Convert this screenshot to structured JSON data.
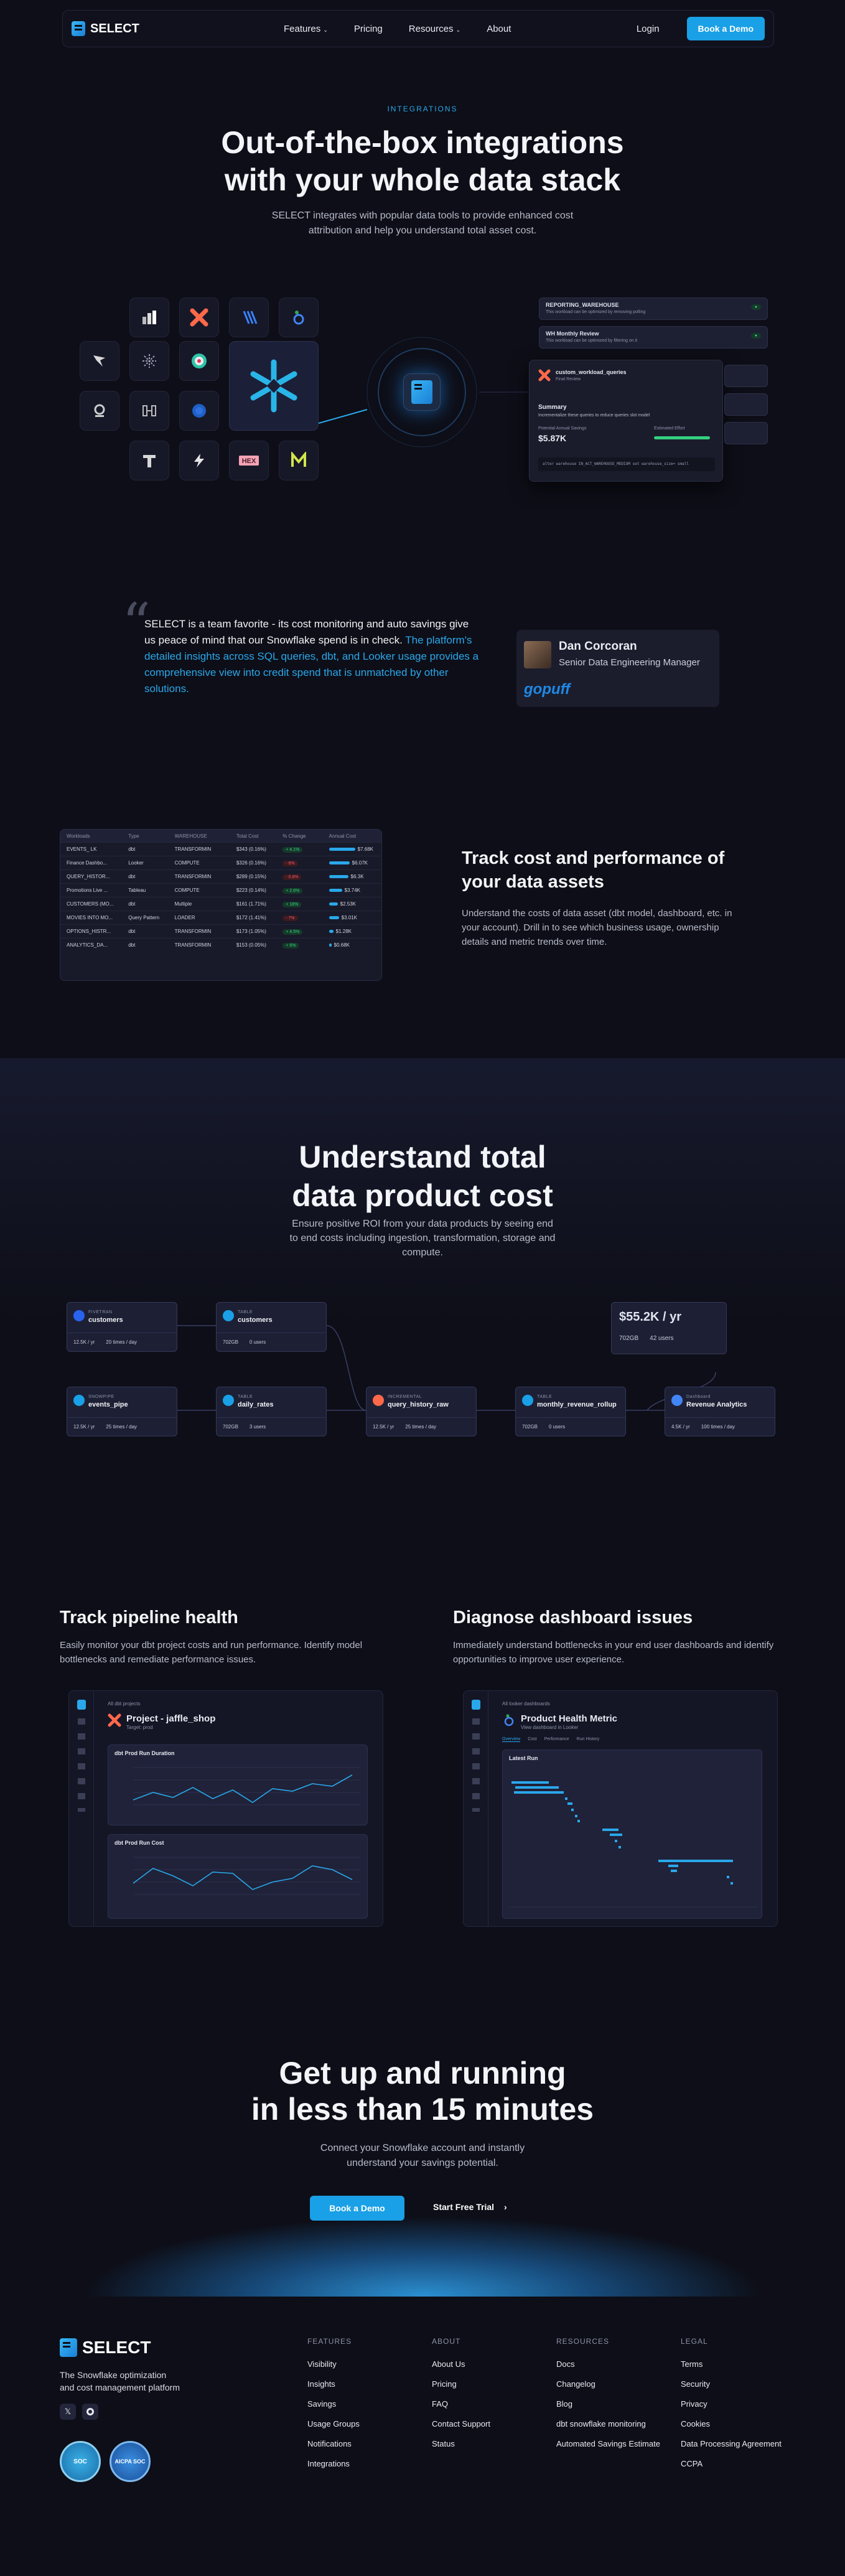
{
  "nav": {
    "brand": "SELECT",
    "links": [
      "Features",
      "Pricing",
      "Resources",
      "About"
    ],
    "login": "Login",
    "cta": "Book a Demo"
  },
  "hero": {
    "eyebrow": "INTEGRATIONS",
    "title_line1": "Out-of-the-box integrations",
    "title_line2": "with your whole data stack",
    "sub_line1": "SELECT integrates with popular data tools to provide enhanced cost",
    "sub_line2": "attribution and help you understand total asset cost."
  },
  "workload_cards": {
    "row1_title": "REPORTING_WAREHOUSE",
    "row1_sub": "This workload can be optimized by removing polling",
    "row2_title": "WH Monthly Review",
    "row2_sub": "This workload can be optimized by filtering on it",
    "main_title": "custom_workload_queries",
    "main_sub": "Final Review",
    "summary_title": "Summary",
    "summary_text": "Incrementalize these queries to reduce queries slot model",
    "savings_label": "Potential Annual Savings",
    "savings_value": "$5.87K",
    "effort_label": "Estimated Effort",
    "code": "alter warehouse IN_ACT_WAREHOUSE_MEDIUM set warehouse_size= small"
  },
  "testimonial": {
    "quote_white": "SELECT is a team favorite - its cost monitoring and auto savings give us peace of mind that our Snowflake spend is in check.",
    "quote_blue": "The platform's detailed insights across SQL queries, dbt, and Looker usage provides a comprehensive view into credit spend that is unmatched by other solutions.",
    "name": "Dan Corcoran",
    "role": "Senior Data Engineering Manager",
    "company": "gopuff"
  },
  "assets_table": {
    "headers": [
      "Workloads",
      "Type",
      "WAREHOUSE",
      "Total Cost",
      "% Change",
      "Annual Cost"
    ],
    "rows": [
      {
        "name": "EVENTS_ LK",
        "type": "dbt",
        "wh": "TRANSFORMIN",
        "cost": "$343 (0.16%)",
        "chg": "+ 4.1%",
        "up": true,
        "annual": "$7.68K",
        "frac": 1.0
      },
      {
        "name": "Finance Dashbo...",
        "type": "Looker",
        "wh": "COMPUTE",
        "cost": "$326 (0.16%)",
        "chg": "- 6%",
        "up": false,
        "annual": "$6.07K",
        "frac": 0.79
      },
      {
        "name": "QUERY_HISTOR...",
        "type": "dbt",
        "wh": "TRANSFORMIN",
        "cost": "$289 (0.15%)",
        "chg": "- 0.8%",
        "up": false,
        "annual": "$6.3K",
        "frac": 0.74
      },
      {
        "name": "Promotions Live ...",
        "type": "Tableau",
        "wh": "COMPUTE",
        "cost": "$223 (0.14%)",
        "chg": "+ 2.6%",
        "up": true,
        "annual": "$3.74K",
        "frac": 0.49
      },
      {
        "name": "CUSTOMERS (MO...",
        "type": "dbt",
        "wh": "Multiple",
        "cost": "$161 (1.71%)",
        "chg": "+ 18%",
        "up": true,
        "annual": "$2.53K",
        "frac": 0.33
      },
      {
        "name": "MOVIES INTO MO...",
        "type": "Query Pattern",
        "wh": "LOADER",
        "cost": "$172 (1.41%)",
        "chg": "- 7%",
        "up": false,
        "annual": "$3.01K",
        "frac": 0.39
      },
      {
        "name": "OPTIONS_HISTR...",
        "type": "dbt",
        "wh": "TRANSFORMIN",
        "cost": "$173 (1.05%)",
        "chg": "+ 4.5%",
        "up": true,
        "annual": "$1.28K",
        "frac": 0.17
      },
      {
        "name": "ANALYTICS_DA...",
        "type": "dbt",
        "wh": "TRANSFORMIN",
        "cost": "$153 (0.05%)",
        "chg": "+ 6%",
        "up": true,
        "annual": "$0.68K",
        "frac": 0.09
      }
    ]
  },
  "track_cost": {
    "title_line1": "Track cost and performance of",
    "title_line2": "your data assets",
    "body": "Understand the costs of data asset (dbt model, dashboard, etc. in your account). Drill in to see which business usage, ownership details and metric trends over time."
  },
  "total_cost": {
    "title_line1": "Understand total",
    "title_line2": "data product cost",
    "sub_line1": "Ensure positive ROI from your data products by seeing end",
    "sub_line2": "to end costs including ingestion, transformation, storage and",
    "sub_line3": "compute."
  },
  "lineage": {
    "nodes": [
      {
        "type": "FIVETRAN",
        "name": "customers",
        "s1": "12.5K / yr",
        "s2": "20 times / day"
      },
      {
        "type": "TABLE",
        "name": "customers",
        "s1": "702GB",
        "s2": "0 users"
      },
      {
        "type": "SNOWPIPE",
        "name": "events_pipe",
        "s1": "12.5K / yr",
        "s2": "25 times / day"
      },
      {
        "type": "TABLE",
        "name": "daily_rates",
        "s1": "702GB",
        "s2": "3 users"
      },
      {
        "type": "INCREMENTAL",
        "name": "query_history_raw",
        "s1": "12.5K / yr",
        "s2": "25 times / day"
      },
      {
        "type": "TABLE",
        "name": "monthly_revenue_rollup",
        "s1": "702GB",
        "s2": "0 users"
      },
      {
        "type": "Dashboard",
        "name": "Revenue Analytics",
        "s1": "4.5K / yr",
        "s2": "100 times / day"
      }
    ],
    "summary_value": "$55.2K / yr",
    "summary_storage": "702GB",
    "summary_users": "42 users"
  },
  "pipeline": {
    "title": "Track pipeline health",
    "body": "Easily monitor your dbt project costs and run performance. Identify model bottlenecks and remediate performance issues.",
    "back": "All dbt projects",
    "project": "Project - jaffle_shop",
    "target": "Target: prod",
    "chart1": "dbt Prod Run Duration",
    "chart2": "dbt Prod Run Cost"
  },
  "dashboard": {
    "title": "Diagnose dashboard issues",
    "body": "Immediately understand bottlenecks in your end user dashboards and identify opportunities to improve user experience.",
    "back": "All looker dashboards",
    "name": "Product Health Metric",
    "link": "View dashboard in Looker",
    "tabs": [
      "Overview",
      "Cost",
      "Performance",
      "Run History"
    ],
    "latest": "Latest Run"
  },
  "cta": {
    "title_line1": "Get up and running",
    "title_line2": "in less than 15 minutes",
    "sub_line1": "Connect your Snowflake account and instantly",
    "sub_line2": "understand your savings potential.",
    "primary": "Book a Demo",
    "secondary": "Start Free Trial"
  },
  "footer": {
    "brand": "SELECT",
    "tagline_line1": "The Snowflake optimization",
    "tagline_line2": "and cost management platform",
    "features_head": "FEATURES",
    "features": [
      "Visibility",
      "Insights",
      "Savings",
      "Usage Groups",
      "Notifications",
      "Integrations"
    ],
    "about_head": "ABOUT",
    "about": [
      "About Us",
      "Pricing",
      "FAQ",
      "Contact Support",
      "Status"
    ],
    "resources_head": "RESOURCES",
    "resources": [
      "Docs",
      "Changelog",
      "Blog",
      "dbt snowflake monitoring",
      "Automated Savings Estimate"
    ],
    "legal_head": "LEGAL",
    "legal": [
      "Terms",
      "Security",
      "Privacy",
      "Cookies",
      "Data Processing Agreement",
      "CCPA"
    ],
    "badge1": "SOC",
    "badge2": "AICPA SOC"
  },
  "colors": {
    "bg": "#0d0e17",
    "accent": "#1aa0e6",
    "blue_text": "#2aa7ea"
  }
}
